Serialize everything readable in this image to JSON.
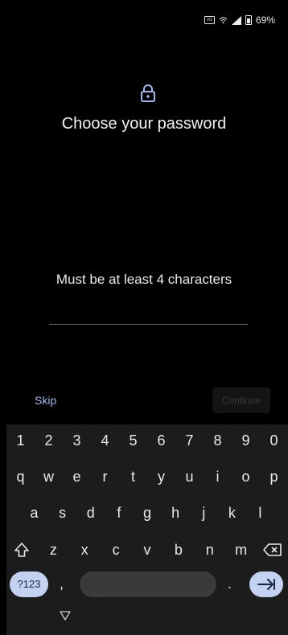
{
  "status_bar": {
    "battery_percent": "69%",
    "icons": [
      "vowifi-icon",
      "wifi-call-icon",
      "signal-icon",
      "battery-icon"
    ]
  },
  "screen": {
    "icon": "lock-icon",
    "title": "Choose your password",
    "hint": "Must be at least 4 characters",
    "password_value": "",
    "skip_label": "Skip",
    "continue_label": "Continue"
  },
  "keyboard": {
    "numbers": [
      "1",
      "2",
      "3",
      "4",
      "5",
      "6",
      "7",
      "8",
      "9",
      "0"
    ],
    "row1": [
      "q",
      "w",
      "e",
      "r",
      "t",
      "y",
      "u",
      "i",
      "o",
      "p"
    ],
    "row2": [
      "a",
      "s",
      "d",
      "f",
      "g",
      "h",
      "j",
      "k",
      "l"
    ],
    "row3": [
      "z",
      "x",
      "c",
      "v",
      "b",
      "n",
      "m"
    ],
    "symbols_label": "?123",
    "comma": ",",
    "period": ".",
    "icons": [
      "shift-icon",
      "backspace-icon",
      "enter-icon",
      "nav-back-icon"
    ]
  },
  "colors": {
    "background": "#000000",
    "accent": "#9db7f2",
    "key_accent_bg": "#c2d2f0",
    "keyboard_bg": "#1c1c1c"
  }
}
